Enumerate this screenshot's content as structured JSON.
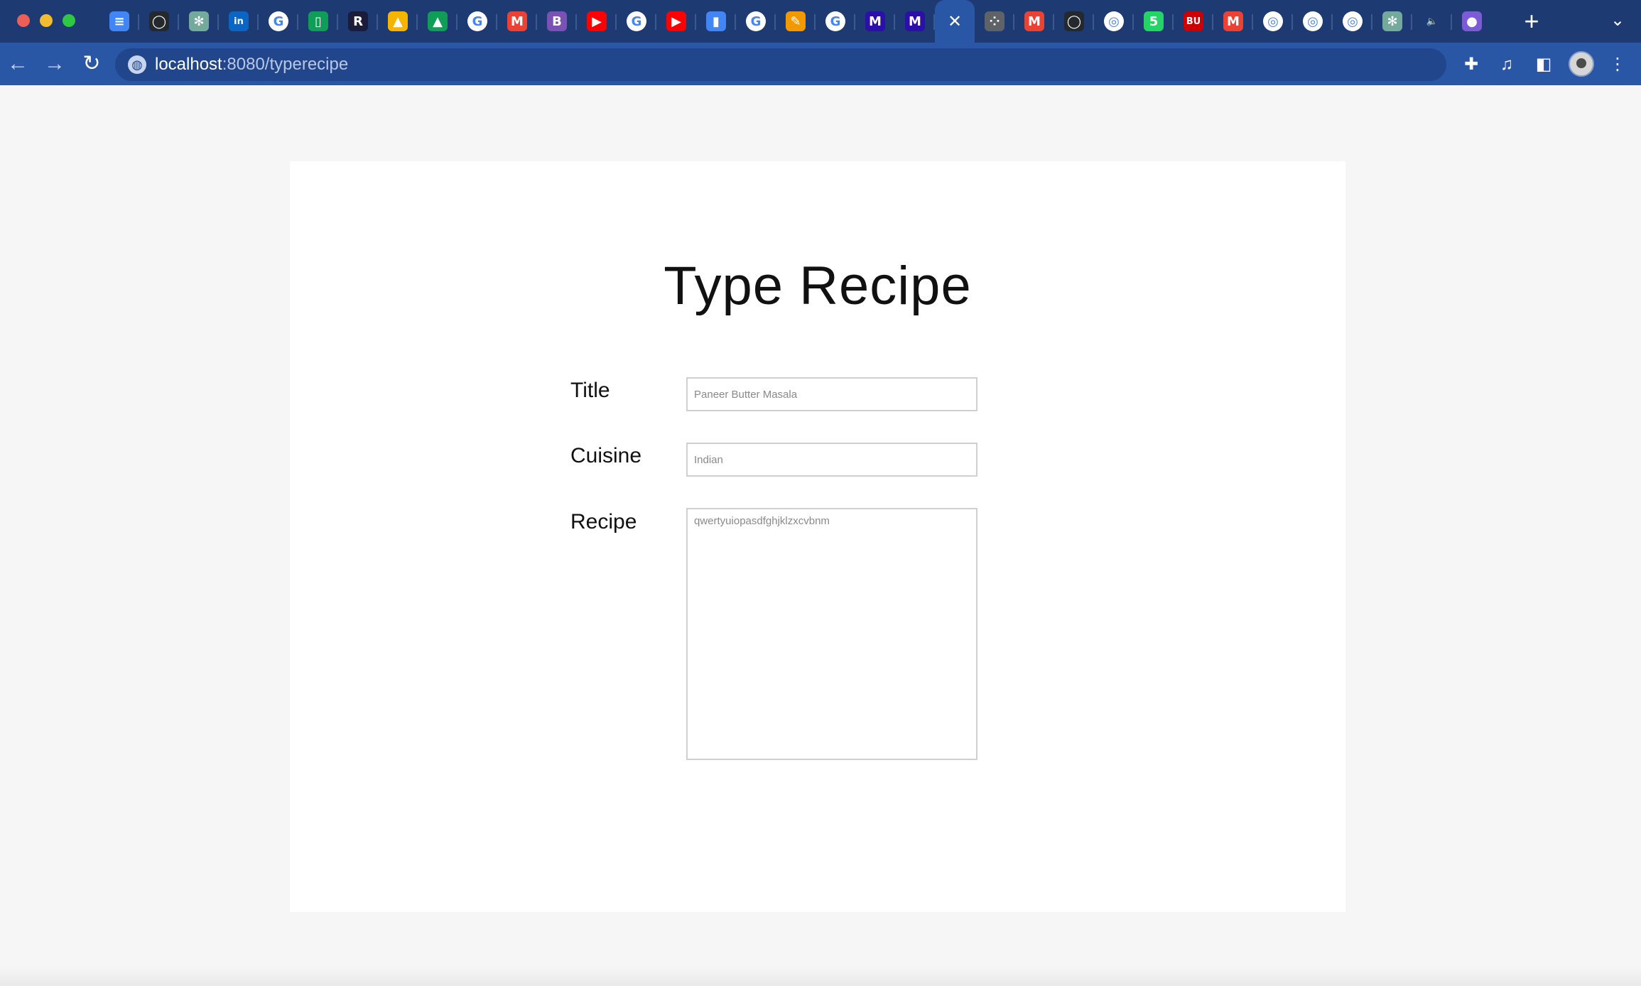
{
  "browser": {
    "tabs": [
      {
        "icon": "docs-icon",
        "color": "#4285f4",
        "glyph": "≡"
      },
      {
        "icon": "github-icon",
        "color": "#24292e",
        "glyph": "◯"
      },
      {
        "icon": "chatgpt-icon",
        "color": "#74aa9c",
        "glyph": "✻"
      },
      {
        "icon": "linkedin-icon",
        "color": "#0a66c2",
        "glyph": "in"
      },
      {
        "icon": "google-icon",
        "color": "#ffffff",
        "glyph": "G"
      },
      {
        "icon": "sheets-icon",
        "color": "#0f9d58",
        "glyph": "▯"
      },
      {
        "icon": "replit-icon",
        "color": "#1b1b3a",
        "glyph": "R"
      },
      {
        "icon": "drive-icon",
        "color": "#f4b400",
        "glyph": "▲"
      },
      {
        "icon": "drive-icon",
        "color": "#0f9d58",
        "glyph": "▲"
      },
      {
        "icon": "google-icon",
        "color": "#ffffff",
        "glyph": "G"
      },
      {
        "icon": "gmail-icon",
        "color": "#ea4335",
        "glyph": "M"
      },
      {
        "icon": "bootstrap-icon",
        "color": "#7952b3",
        "glyph": "B"
      },
      {
        "icon": "youtube-icon",
        "color": "#ff0000",
        "glyph": "▶"
      },
      {
        "icon": "google-icon",
        "color": "#ffffff",
        "glyph": "G"
      },
      {
        "icon": "youtube-icon",
        "color": "#ff0000",
        "glyph": "▶"
      },
      {
        "icon": "analytics-icon",
        "color": "#4285f4",
        "glyph": "▮"
      },
      {
        "icon": "google-icon",
        "color": "#ffffff",
        "glyph": "G"
      },
      {
        "icon": "pencil-icon",
        "color": "#f29900",
        "glyph": "✎"
      },
      {
        "icon": "google-icon",
        "color": "#ffffff",
        "glyph": "G"
      },
      {
        "icon": "m-icon",
        "color": "#2b0fa8",
        "glyph": "M"
      },
      {
        "icon": "m-icon",
        "color": "#2b0fa8",
        "glyph": "M"
      },
      {
        "icon": "close-icon",
        "color": "#2a56a6",
        "glyph": "✕",
        "active": true
      },
      {
        "icon": "apps-icon",
        "color": "#5f6368",
        "glyph": "⁘"
      },
      {
        "icon": "gmail-icon",
        "color": "#ea4335",
        "glyph": "M"
      },
      {
        "icon": "github-icon",
        "color": "#24292e",
        "glyph": "◯"
      },
      {
        "icon": "chrome-icon",
        "color": "#ffffff",
        "glyph": "◎"
      },
      {
        "icon": "whatsapp-icon",
        "color": "#25d366",
        "glyph": "5"
      },
      {
        "icon": "bu-icon",
        "color": "#cc0000",
        "glyph": "BU"
      },
      {
        "icon": "gmail-icon",
        "color": "#ea4335",
        "glyph": "M"
      },
      {
        "icon": "chrome-icon",
        "color": "#ffffff",
        "glyph": "◎"
      },
      {
        "icon": "chrome-icon",
        "color": "#ffffff",
        "glyph": "◎"
      },
      {
        "icon": "chrome-icon",
        "color": "#ffffff",
        "glyph": "◎"
      },
      {
        "icon": "chatgpt-icon",
        "color": "#74aa9c",
        "glyph": "✻"
      },
      {
        "icon": "speaker-icon",
        "color": "#1d3a73",
        "glyph": "🔈"
      },
      {
        "icon": "orb-icon",
        "color": "#7b5bd6",
        "glyph": "●"
      }
    ],
    "new_tab_glyph": "+",
    "tab_list_glyph": "⌄",
    "back_glyph": "←",
    "forward_glyph": "→",
    "reload_glyph": "↻",
    "url_host": "localhost",
    "url_path": ":8080/typerecipe",
    "extensions_glyph": "✚",
    "media_glyph": "♫",
    "sidepanel_glyph": "◧",
    "menu_glyph": "⋮"
  },
  "form": {
    "heading": "Type Recipe",
    "title_label": "Title",
    "title_placeholder": "Paneer Butter Masala",
    "cuisine_label": "Cuisine",
    "cuisine_placeholder": "Indian",
    "recipe_label": "Recipe",
    "recipe_placeholder": "qwertyuiopasdfghjklzxcvbnm"
  }
}
